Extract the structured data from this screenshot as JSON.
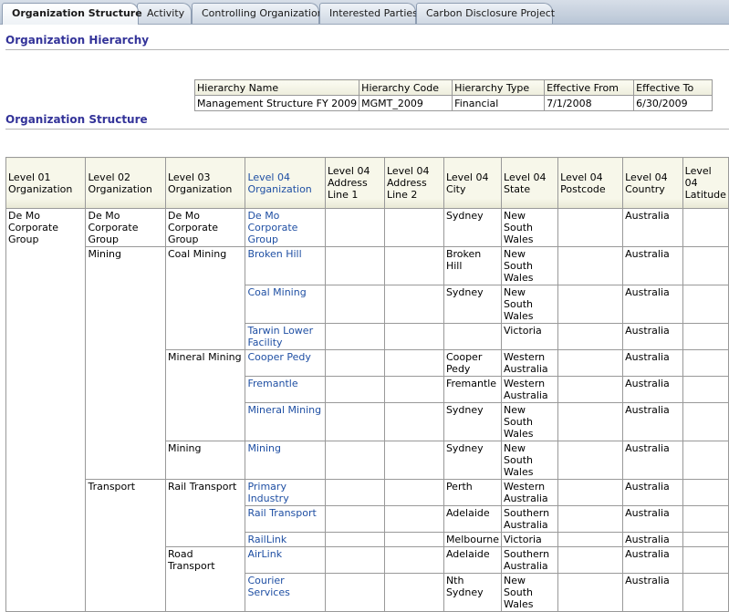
{
  "tabs": [
    {
      "label": "Organization Structure",
      "active": true
    },
    {
      "label": "Activity"
    },
    {
      "label": "Controlling Organizations"
    },
    {
      "label": "Interested Parties"
    },
    {
      "label": "Carbon Disclosure Project"
    }
  ],
  "hierarchy_section": {
    "title": "Organization Hierarchy",
    "headers": [
      "Hierarchy Name",
      "Hierarchy Code",
      "Hierarchy Type",
      "Effective From",
      "Effective To"
    ],
    "row": [
      "Management Structure FY 2009",
      "MGMT_2009",
      "Financial",
      "7/1/2008",
      "6/30/2009"
    ]
  },
  "structure_section": {
    "title": "Organization Structure",
    "headers": [
      "Level 01 Organization",
      "Level 02 Organization",
      "Level 03 Organization",
      "Level 04 Organization",
      "Level 04 Address Line 1",
      "Level 04 Address Line 2",
      "Level 04 City",
      "Level 04 State",
      "Level 04 Postcode",
      "Level 04 Country",
      "Level 04 Latitude"
    ],
    "level1": "De Mo Corporate Group",
    "level2": [
      "De Mo Corporate Group",
      "Mining",
      "Transport"
    ],
    "level3": [
      "De Mo Corporate Group",
      "Coal Mining",
      "Mineral Mining",
      "Mining",
      "Rail Transport",
      "Road Transport"
    ],
    "rows": [
      {
        "l4": "De Mo Corporate Group",
        "addr1": "",
        "addr2": "",
        "city": "Sydney",
        "state": "New South Wales",
        "postcode": "",
        "country": "Australia",
        "lat": ""
      },
      {
        "l4": "Broken Hill",
        "addr1": "",
        "addr2": "",
        "city": "Broken Hill",
        "state": "New South Wales",
        "postcode": "",
        "country": "Australia",
        "lat": ""
      },
      {
        "l4": "Coal Mining",
        "addr1": "",
        "addr2": "",
        "city": "Sydney",
        "state": "New South Wales",
        "postcode": "",
        "country": "Australia",
        "lat": ""
      },
      {
        "l4": "Tarwin Lower Facility",
        "addr1": "",
        "addr2": "",
        "city": "",
        "state": "Victoria",
        "postcode": "",
        "country": "Australia",
        "lat": ""
      },
      {
        "l4": "Cooper Pedy",
        "addr1": "",
        "addr2": "",
        "city": "Cooper Pedy",
        "state": "Western Australia",
        "postcode": "",
        "country": "Australia",
        "lat": ""
      },
      {
        "l4": "Fremantle",
        "addr1": "",
        "addr2": "",
        "city": "Fremantle",
        "state": "Western Australia",
        "postcode": "",
        "country": "Australia",
        "lat": ""
      },
      {
        "l4": "Mineral Mining",
        "addr1": "",
        "addr2": "",
        "city": "Sydney",
        "state": "New South Wales",
        "postcode": "",
        "country": "Australia",
        "lat": ""
      },
      {
        "l4": "Mining",
        "addr1": "",
        "addr2": "",
        "city": "Sydney",
        "state": "New South Wales",
        "postcode": "",
        "country": "Australia",
        "lat": ""
      },
      {
        "l4": "Primary Industry",
        "addr1": "",
        "addr2": "",
        "city": "Perth",
        "state": "Western Australia",
        "postcode": "",
        "country": "Australia",
        "lat": ""
      },
      {
        "l4": "Rail Transport",
        "addr1": "",
        "addr2": "",
        "city": "Adelaide",
        "state": "Southern Australia",
        "postcode": "",
        "country": "Australia",
        "lat": ""
      },
      {
        "l4": "RailLink",
        "addr1": "",
        "addr2": "",
        "city": "Melbourne",
        "state": "Victoria",
        "postcode": "",
        "country": "Australia",
        "lat": ""
      },
      {
        "l4": "AirLink",
        "addr1": "",
        "addr2": "",
        "city": "Adelaide",
        "state": "Southern Australia",
        "postcode": "",
        "country": "Australia",
        "lat": ""
      },
      {
        "l4": "Courier Services",
        "addr1": "",
        "addr2": "",
        "city": "Nth Sydney",
        "state": "New South Wales",
        "postcode": "",
        "country": "Australia",
        "lat": ""
      }
    ]
  }
}
